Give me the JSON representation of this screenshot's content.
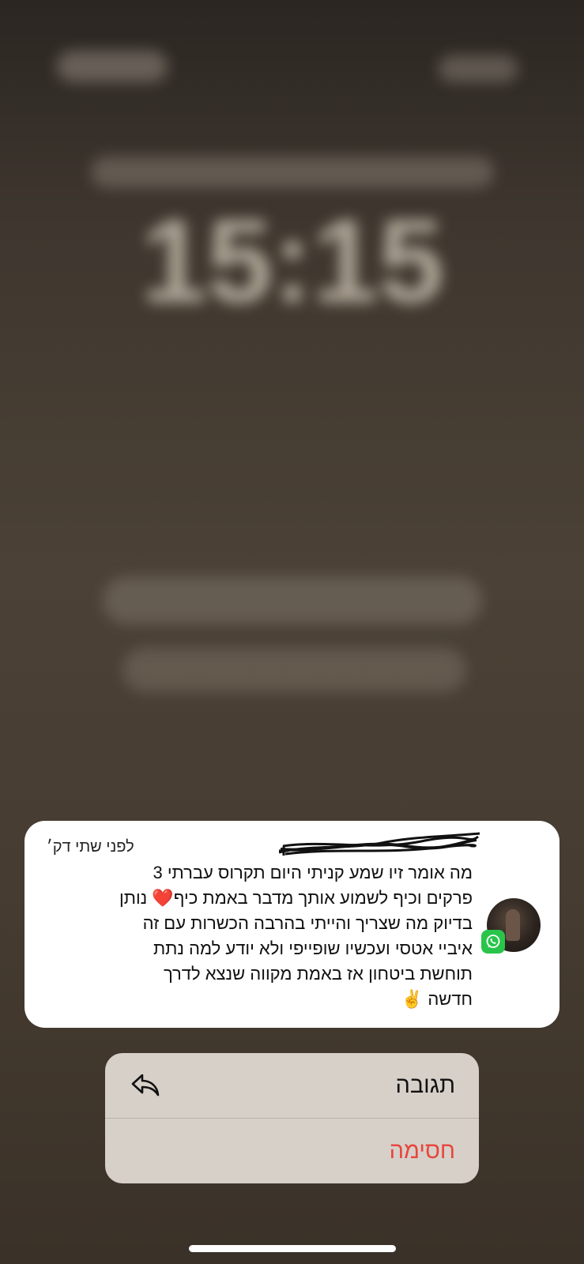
{
  "lockscreen": {
    "time": "15:15"
  },
  "notification": {
    "app_icon": "whatsapp-icon",
    "time_ago": "לפני שתי דק׳",
    "message_lines": [
      "מה אומר זיו שמע קניתי היום תקרוס עברתי 3",
      "פרקים וכיף לשמוע אותך מדבר באמת כיף❤️ נותן",
      "בדיוק מה שצריך והייתי בהרבה הכשרות עם זה",
      "איביי אטסי ועכשיו שופייפי ולא יודע למה נתת",
      "תוחשת ביטחון אז באמת מקווה שנצא לדרך",
      "חדשה ✌️"
    ]
  },
  "actions": {
    "reply_label": "תגובה",
    "reply_icon": "reply-arrow-icon",
    "block_label": "חסימה",
    "colors": {
      "block": "#e8453c"
    }
  }
}
